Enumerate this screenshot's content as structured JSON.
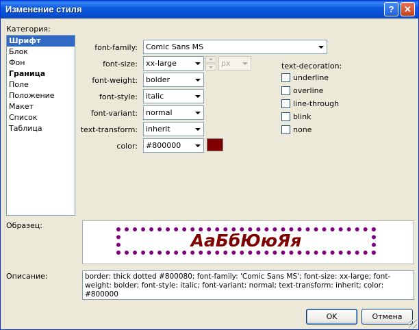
{
  "window": {
    "title": "Изменение стиля",
    "help_label": "?",
    "close_label": "✕"
  },
  "category": {
    "label": "Категория:",
    "items": [
      {
        "label": "Шрифт",
        "selected": true,
        "bold": true
      },
      {
        "label": "Блок",
        "selected": false,
        "bold": false
      },
      {
        "label": "Фон",
        "selected": false,
        "bold": false
      },
      {
        "label": "Граница",
        "selected": false,
        "bold": true
      },
      {
        "label": "Поле",
        "selected": false,
        "bold": false
      },
      {
        "label": "Положение",
        "selected": false,
        "bold": false
      },
      {
        "label": "Макет",
        "selected": false,
        "bold": false
      },
      {
        "label": "Список",
        "selected": false,
        "bold": false
      },
      {
        "label": "Таблица",
        "selected": false,
        "bold": false
      }
    ]
  },
  "font": {
    "family": {
      "label": "font-family:",
      "value": "Comic Sans MS"
    },
    "size": {
      "label": "font-size:",
      "value": "xx-large",
      "unit": "px"
    },
    "weight": {
      "label": "font-weight:",
      "value": "bolder"
    },
    "style": {
      "label": "font-style:",
      "value": "italic"
    },
    "variant": {
      "label": "font-variant:",
      "value": "normal"
    },
    "transform": {
      "label": "text-transform:",
      "value": "inherit"
    },
    "color": {
      "label": "color:",
      "value": "#800000",
      "swatch": "#800000"
    }
  },
  "decoration": {
    "label": "text-decoration:",
    "options": [
      {
        "label": "underline",
        "checked": false
      },
      {
        "label": "overline",
        "checked": false
      },
      {
        "label": "line-through",
        "checked": false
      },
      {
        "label": "blink",
        "checked": false
      },
      {
        "label": "none",
        "checked": false
      }
    ]
  },
  "preview": {
    "label": "Образец:",
    "sample_text": "АаБбЮюЯя",
    "text_color": "#800000",
    "border_color": "#800080"
  },
  "description": {
    "label": "Описание:",
    "text": "border: thick dotted #800080; font-family: 'Comic Sans MS'; font-size: xx-large; font-weight: bolder; font-style: italic; font-variant: normal; text-transform: inherit; color: #800000"
  },
  "buttons": {
    "ok_label": "OK",
    "cancel_label": "Отмена"
  }
}
